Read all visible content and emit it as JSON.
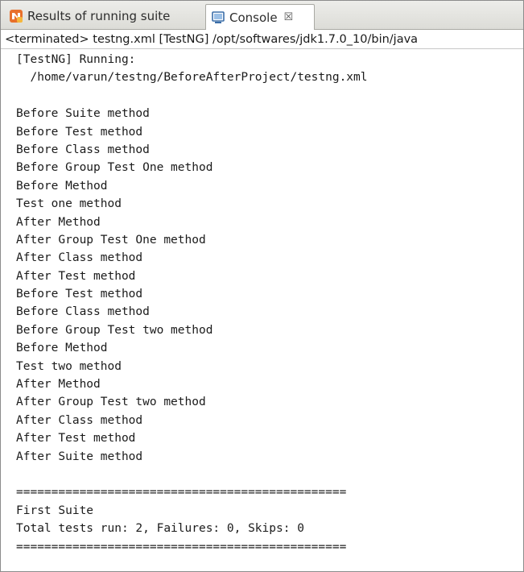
{
  "tabs": {
    "results": {
      "label": "Results of running suite",
      "icon": "testng-icon"
    },
    "console": {
      "label": "Console",
      "close_glyph": "☒",
      "icon": "console-icon"
    }
  },
  "status": {
    "text": "<terminated> testng.xml [TestNG] /opt/softwares/jdk1.7.0_10/bin/java"
  },
  "console": {
    "lines": [
      "[TestNG] Running:",
      "  /home/varun/testng/BeforeAfterProject/testng.xml",
      "",
      "Before Suite method",
      "Before Test method",
      "Before Class method",
      "Before Group Test One method",
      "Before Method",
      "Test one method",
      "After Method",
      "After Group Test One method",
      "After Class method",
      "After Test method",
      "Before Test method",
      "Before Class method",
      "Before Group Test two method",
      "Before Method",
      "Test two method",
      "After Method",
      "After Group Test two method",
      "After Class method",
      "After Test method",
      "After Suite method",
      "",
      "===============================================",
      "First Suite",
      "Total tests run: 2, Failures: 0, Skips: 0",
      "==============================================="
    ]
  },
  "colors": {
    "tab_bar": "#e4e4e0",
    "border": "#a9a9a3",
    "text": "#1b1b1b",
    "testng_orange": "#e8702a",
    "console_blue": "#3b6ea8"
  }
}
